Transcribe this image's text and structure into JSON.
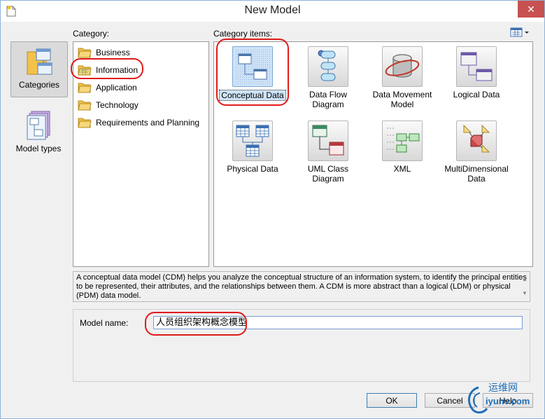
{
  "window": {
    "title": "New Model",
    "close_glyph": "✕"
  },
  "nav": {
    "items": [
      {
        "label": "Categories",
        "icon": "categories-icon",
        "selected": true
      },
      {
        "label": "Model types",
        "icon": "model-types-icon",
        "selected": false
      }
    ]
  },
  "category": {
    "header": "Category:",
    "items": [
      {
        "label": "Business",
        "selected": false
      },
      {
        "label": "Information",
        "selected": true
      },
      {
        "label": "Application",
        "selected": false
      },
      {
        "label": "Technology",
        "selected": false
      },
      {
        "label": "Requirements and Planning",
        "selected": false
      }
    ]
  },
  "category_items": {
    "header": "Category items:",
    "view_icon": "view-mode-icon",
    "tiles": [
      {
        "label": "Conceptual Data",
        "icon": "conceptual-data-icon",
        "selected": true
      },
      {
        "label": "Data Flow Diagram",
        "icon": "data-flow-diagram-icon",
        "selected": false
      },
      {
        "label": "Data Movement Model",
        "icon": "data-movement-model-icon",
        "selected": false
      },
      {
        "label": "Logical Data",
        "icon": "logical-data-icon",
        "selected": false
      },
      {
        "label": "Physical Data",
        "icon": "physical-data-icon",
        "selected": false
      },
      {
        "label": "UML Class Diagram",
        "icon": "uml-class-diagram-icon",
        "selected": false
      },
      {
        "label": "XML",
        "icon": "xml-icon",
        "selected": false
      },
      {
        "label": "MultiDimensional Data",
        "icon": "multidimensional-data-icon",
        "selected": false
      }
    ]
  },
  "description": "A conceptual data model (CDM) helps you analyze the conceptual structure of an information system, to identify the principal entities to be represented, their attributes, and the relationships between them. A CDM is more abstract than a logical (LDM) or physical (PDM) data model.",
  "model_name": {
    "label": "Model name:",
    "value": "人员组织架构概念模型"
  },
  "buttons": {
    "ok": "OK",
    "cancel": "Cancel",
    "help": "Help"
  },
  "watermark": {
    "line1": "运维网",
    "line2": "iyunv.com"
  },
  "colors": {
    "annotation": "#e01a1a",
    "selection": "#cfe3f7",
    "watermark_blue": "#1f6fb8"
  }
}
